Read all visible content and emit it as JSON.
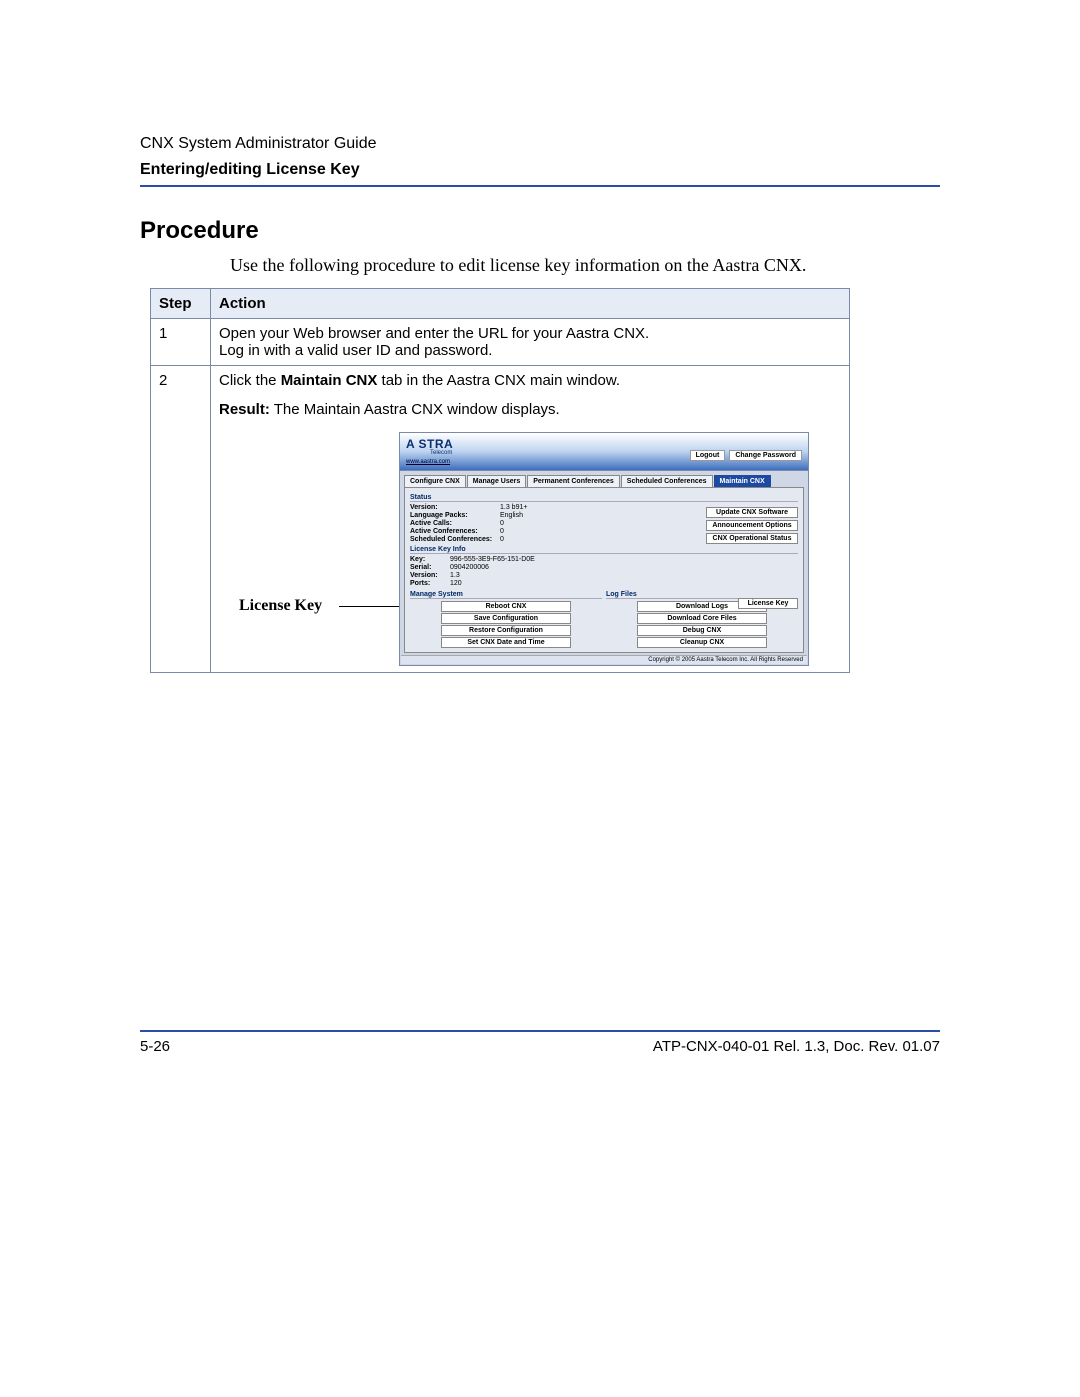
{
  "doc": {
    "guide_title": "CNX System Administrator Guide",
    "section_title": "Entering/editing License Key",
    "heading": "Procedure",
    "intro": "Use the following procedure to edit license key information on the Aastra CNX.",
    "page_number": "5-26",
    "doc_ref": "ATP-CNX-040-01 Rel. 1.3, Doc. Rev. 01.07"
  },
  "table": {
    "head_step": "Step",
    "head_action": "Action",
    "row1_step": "1",
    "row1_line1": "Open your Web browser and enter the URL for your Aastra CNX.",
    "row1_line2": "Log in with a valid user ID and password.",
    "row2_step": "2",
    "row2_prefix": "Click the ",
    "row2_bold": "Maintain CNX",
    "row2_suffix": " tab in the Aastra CNX main window.",
    "row2_result_label": "Result:",
    "row2_result_text": " The Maintain Aastra CNX window displays."
  },
  "callout": {
    "label": "License Key"
  },
  "cnx": {
    "logo": "A  STRA",
    "logo_sub": "Telecom",
    "logo_link": "www.aastra.com",
    "btn_logout": "Logout",
    "btn_changepw": "Change Password",
    "tabs": {
      "configure": "Configure CNX",
      "users": "Manage Users",
      "perm": "Permanent Conferences",
      "sched": "Scheduled Conferences",
      "maintain": "Maintain CNX"
    },
    "sections": {
      "status": "Status",
      "license": "License Key Info",
      "manage": "Manage System",
      "logs": "Log Files"
    },
    "status": {
      "version_k": "Version:",
      "version_v": "1.3 b91+",
      "lang_k": "Language Packs:",
      "lang_v": "English",
      "calls_k": "Active Calls:",
      "calls_v": "0",
      "conf_k": "Active Conferences:",
      "conf_v": "0",
      "sched_k": "Scheduled Conferences:",
      "sched_v": "0"
    },
    "license": {
      "key_k": "Key:",
      "key_v": "996-555-3E9-F65-151-D0E",
      "serial_k": "Serial:",
      "serial_v": "0904200006",
      "version_k": "Version:",
      "version_v": "1.3",
      "ports_k": "Ports:",
      "ports_v": "120"
    },
    "right_buttons": {
      "update": "Update CNX Software",
      "announce": "Announcement Options",
      "opstatus": "CNX Operational Status",
      "license": "License Key"
    },
    "manage_buttons": {
      "reboot": "Reboot CNX",
      "save": "Save Configuration",
      "restore": "Restore Configuration",
      "datetime": "Set CNX Date and Time"
    },
    "log_buttons": {
      "download_logs": "Download Logs",
      "download_core": "Download Core Files",
      "debug": "Debug CNX",
      "cleanup": "Cleanup CNX"
    },
    "copyright": "Copyright © 2005 Aastra Telecom Inc. All Rights Reserved"
  }
}
